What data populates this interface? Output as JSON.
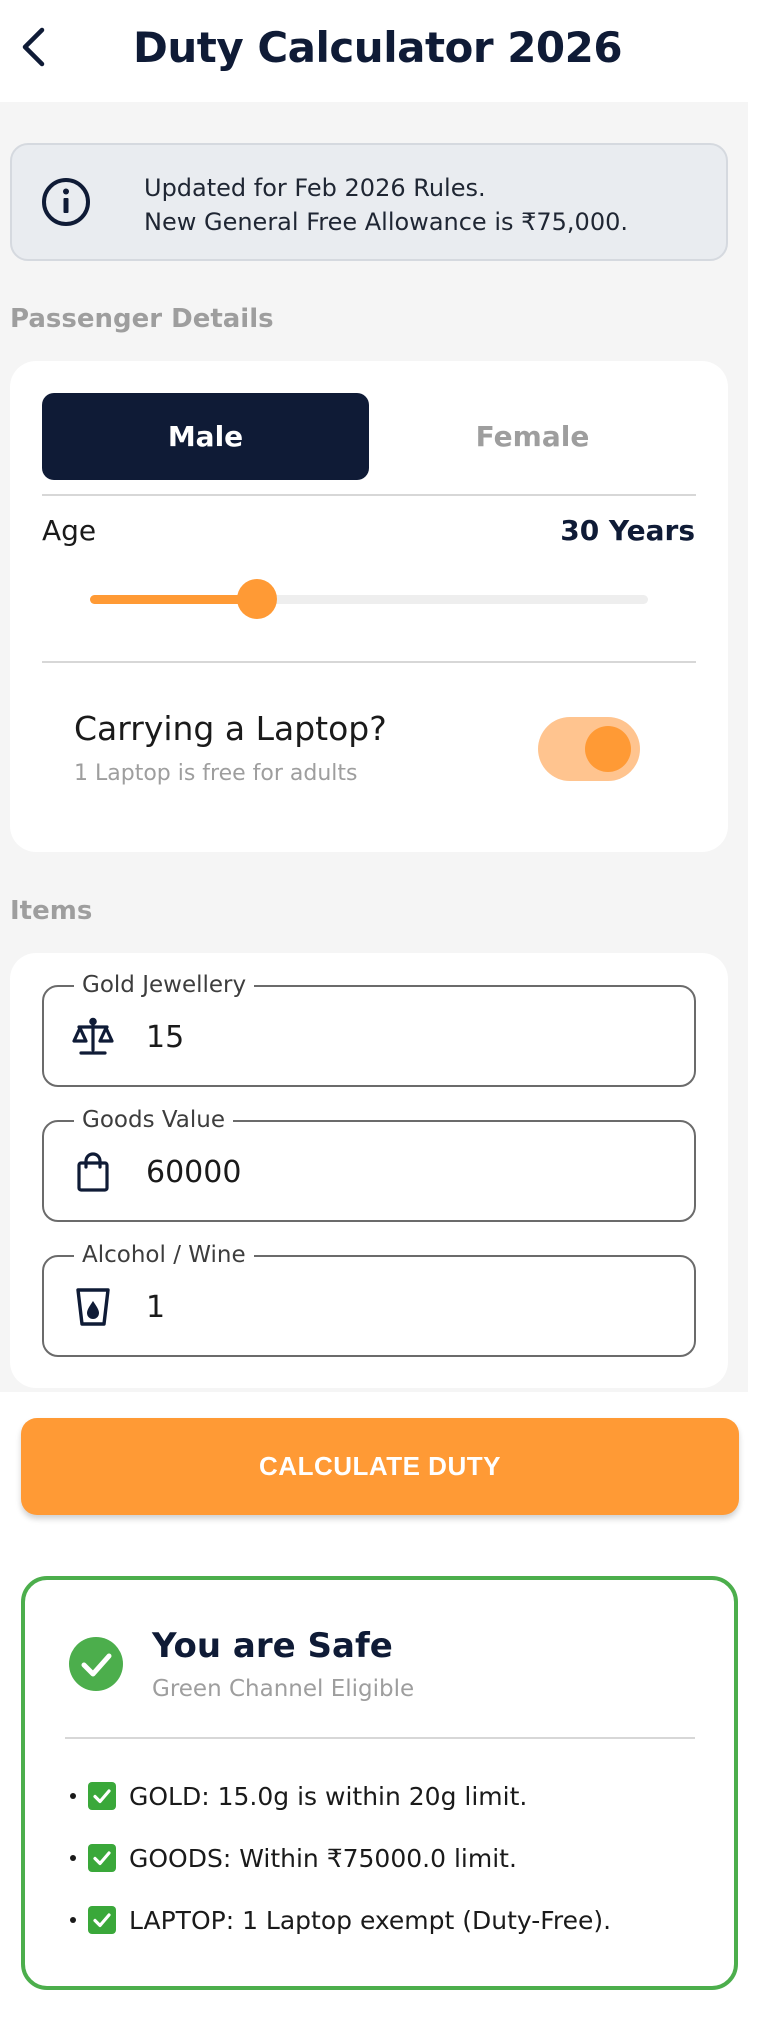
{
  "app_bar": {
    "title": "Duty Calculator 2026",
    "back_icon": "chevron-left-icon"
  },
  "info_banner": {
    "line1": "Updated for Feb 2026 Rules.",
    "line2": "New General Free Allowance is ₹75,000.",
    "icon": "info-icon"
  },
  "passenger": {
    "section_label": "Passenger Details",
    "gender_options": [
      "Male",
      "Female"
    ],
    "selected_gender": "Male",
    "age_label": "Age",
    "age_value_text": "30 Years",
    "age_slider_fraction": 0.3,
    "laptop": {
      "title": "Carrying a Laptop?",
      "subtitle": "1 Laptop is free for adults",
      "enabled": true
    }
  },
  "items": {
    "section_label": "Items",
    "fields": [
      {
        "label": "Gold Jewellery",
        "value": "15",
        "icon": "scale-icon"
      },
      {
        "label": "Goods Value",
        "value": "60000",
        "icon": "shopping-bag-icon"
      },
      {
        "label": "Alcohol / Wine",
        "value": "1",
        "icon": "liquor-glass-icon"
      }
    ]
  },
  "calculate_button": {
    "label": "CALCULATE DUTY"
  },
  "result": {
    "title": "You are Safe",
    "subtitle": "Green Channel Eligible",
    "icon": "check-circle-icon",
    "items": [
      "GOLD: 15.0g is within 20g limit.",
      "GOODS: Within ₹75000.0 limit.",
      "LAPTOP: 1 Laptop exempt (Duty-Free)."
    ]
  },
  "colors": {
    "primary_dark": "#0f1b36",
    "accent_orange": "#ff9a35",
    "success_green": "#4cae4c",
    "muted_text": "#9e9e9e"
  }
}
